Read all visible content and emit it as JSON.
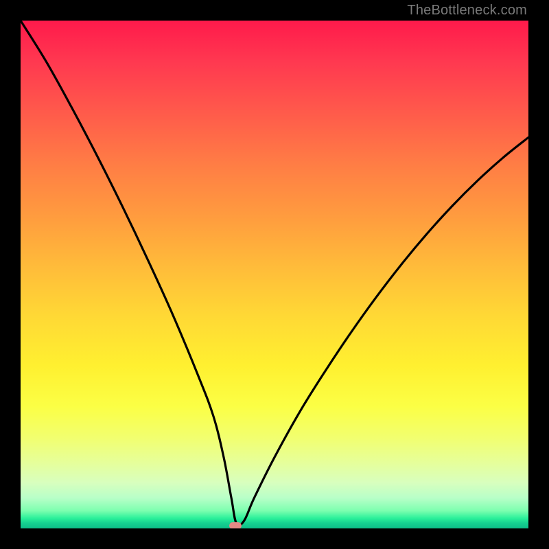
{
  "watermark": "TheBottleneck.com",
  "colors": {
    "frame": "#000000",
    "curve": "#000000",
    "marker": "#e58a86",
    "watermark": "#7a7a7a",
    "gradient_top": "#ff1a4b",
    "gradient_mid": "#fff030",
    "gradient_bottom": "#0ebd88"
  },
  "chart_data": {
    "type": "line",
    "title": "",
    "xlabel": "",
    "ylabel": "",
    "xlim": [
      0,
      100
    ],
    "ylim": [
      0,
      100
    ],
    "grid": false,
    "legend": false,
    "note": "Axes and ticks are not labeled in the source image. x/y are in percent of plot width/height; y increases upward. The curve is a V-shaped bottleneck profile with a minimum near x≈42.",
    "series": [
      {
        "name": "bottleneck-curve",
        "x": [
          0,
          5,
          10,
          15,
          20,
          25,
          30,
          35,
          38,
          40,
          41.5,
          42.5,
          44,
          46,
          50,
          55,
          60,
          65,
          70,
          75,
          80,
          85,
          90,
          95,
          100
        ],
        "y": [
          100,
          92,
          83,
          73.5,
          63.5,
          53,
          42,
          30,
          22,
          14,
          6,
          1,
          1.5,
          6,
          14,
          23,
          31,
          38.5,
          45.5,
          52,
          58,
          63.5,
          68.5,
          73,
          77
        ]
      }
    ],
    "annotations": [
      {
        "name": "min-marker",
        "x": 42.3,
        "y": 0.6,
        "shape": "pill",
        "color": "#e58a86"
      }
    ]
  }
}
